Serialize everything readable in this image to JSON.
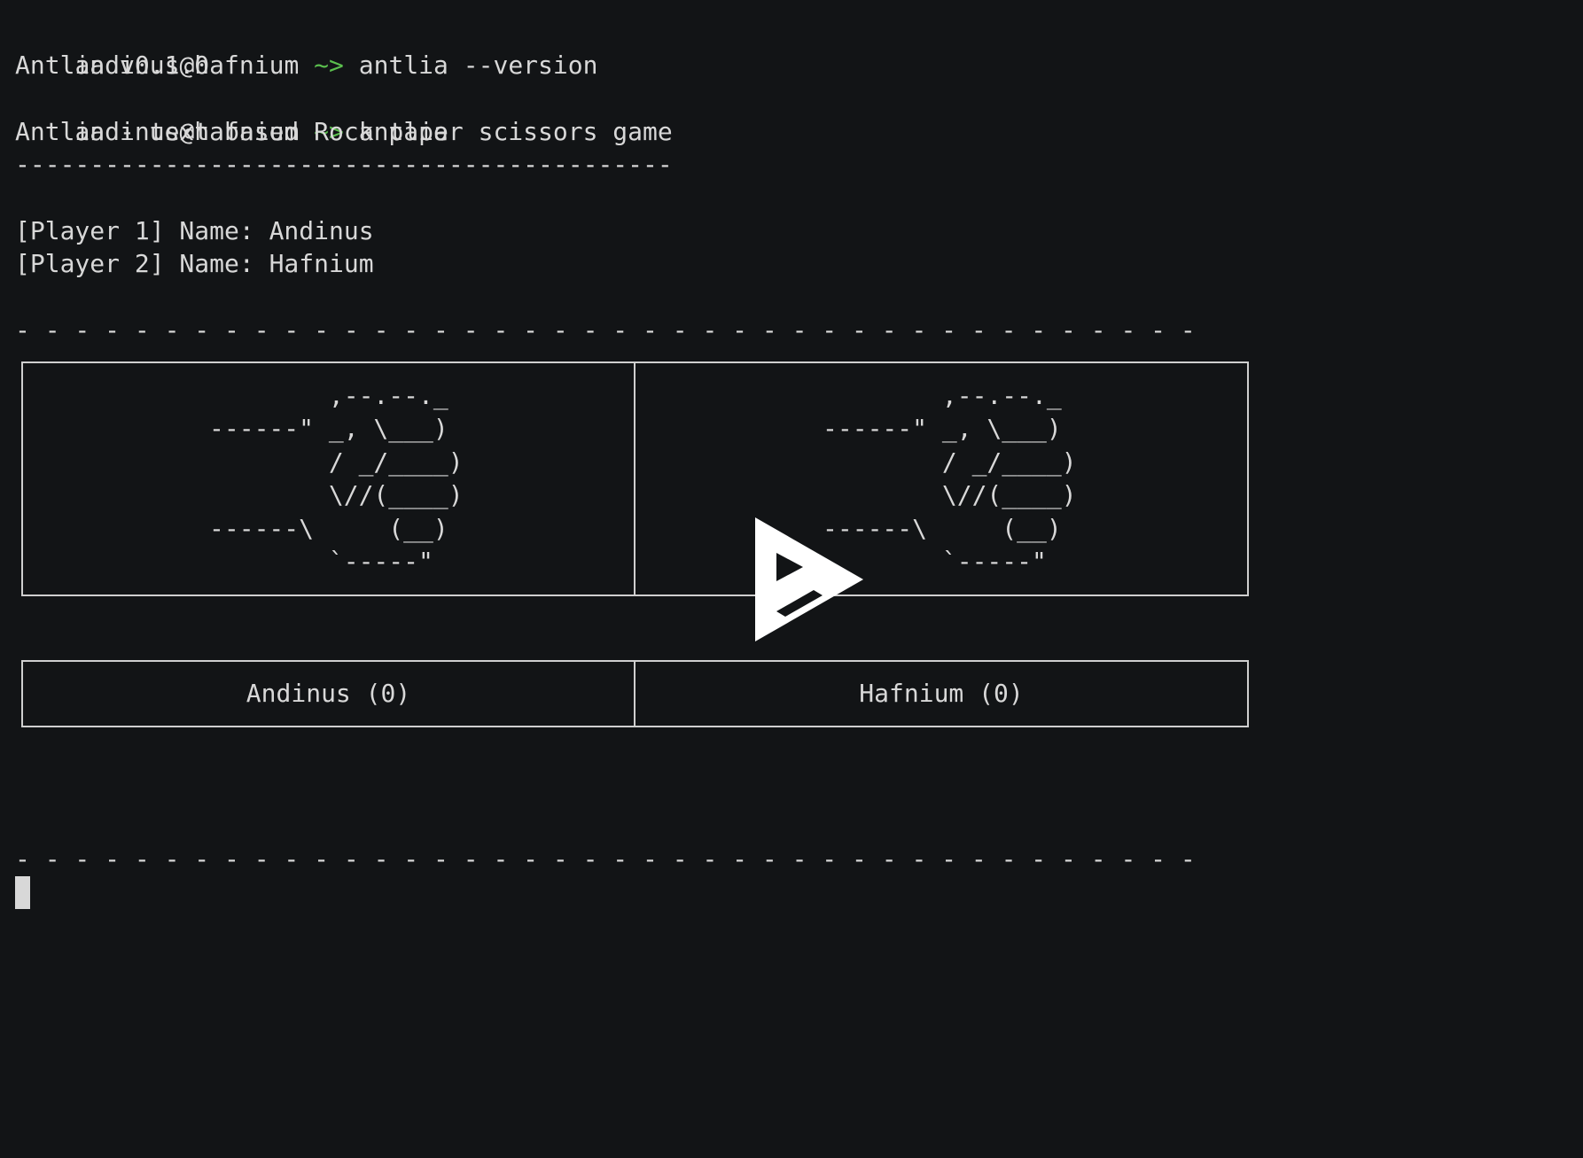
{
  "session": {
    "lines": [
      {
        "user": "andinus@hafnium",
        "sym": " ~> ",
        "cmd": "antlia --version"
      },
      {
        "text": "Antlia v0.1.0"
      },
      {
        "user": "andinus@hafnium",
        "sym": " ~> ",
        "cmd": "antlia"
      },
      {
        "text": "Antlia - text based Rock paper scissors game"
      },
      {
        "text": "--------------------------------------------"
      },
      {
        "text": ""
      },
      {
        "text": "[Player 1] Name: Andinus"
      },
      {
        "text": "[Player 2] Name: Hafnium"
      },
      {
        "text": ""
      },
      {
        "text": "- - - - - - - - - - - - - - - - - - - - - - - - - - - - - - - - - - - - - - - -"
      }
    ],
    "bottom_rule": "- - - - - - - - - - - - - - - - - - - - - - - - - - - - - - - - - - - - - - - -"
  },
  "game": {
    "left_art": "        ,--.--._\n------\" _, \\___)\n        / _/____)\n        \\//(____)\n------\\     (__)\n        `-----\"",
    "right_art": "        ,--.--._\n------\" _, \\___)\n        / _/____)\n        \\//(____)\n------\\     (__)\n        `-----\"",
    "player1_score": "Andinus (0)",
    "player2_score": "Hafnium (0)"
  },
  "overlay": {
    "icon": "play-icon"
  },
  "colors": {
    "background": "#121416",
    "text": "#d8d8d8",
    "prompt_symbol": "#5bbf4e",
    "border": "#cfcfcf"
  }
}
